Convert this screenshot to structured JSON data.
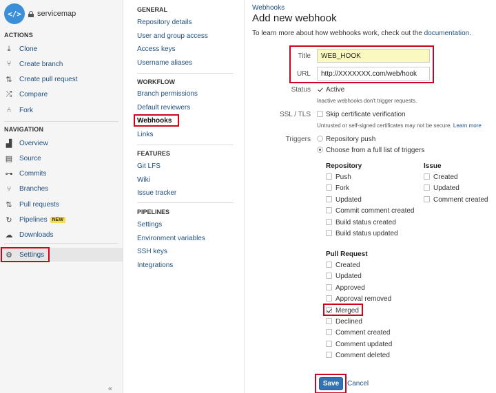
{
  "repo": {
    "avatar_glyph": "</>",
    "name": "servicemap",
    "avatar_color": "#3b8fd8"
  },
  "sidebar": {
    "actions_heading": "ACTIONS",
    "actions": [
      {
        "label": "Clone",
        "icon": "download-icon",
        "glyph": "⤓"
      },
      {
        "label": "Create branch",
        "icon": "branch-icon",
        "glyph": "⑂"
      },
      {
        "label": "Create pull request",
        "icon": "pull-request-icon",
        "glyph": "⇅"
      },
      {
        "label": "Compare",
        "icon": "compare-icon",
        "glyph": "⤮"
      },
      {
        "label": "Fork",
        "icon": "fork-icon",
        "glyph": "⑃"
      }
    ],
    "navigation_heading": "NAVIGATION",
    "navigation": [
      {
        "label": "Overview",
        "icon": "overview-icon",
        "glyph": "▟"
      },
      {
        "label": "Source",
        "icon": "source-icon",
        "glyph": "▤"
      },
      {
        "label": "Commits",
        "icon": "commits-icon",
        "glyph": "⊶"
      },
      {
        "label": "Branches",
        "icon": "branches-icon",
        "glyph": "⑂"
      },
      {
        "label": "Pull requests",
        "icon": "pull-requests-icon",
        "glyph": "⇅"
      },
      {
        "label": "Pipelines",
        "icon": "pipelines-icon",
        "glyph": "↻",
        "badge": "NEW"
      },
      {
        "label": "Downloads",
        "icon": "downloads-icon",
        "glyph": "☁"
      }
    ],
    "settings": {
      "label": "Settings",
      "icon": "gear-icon",
      "glyph": "⚙"
    },
    "collapse": "«"
  },
  "settings_nav": {
    "general_heading": "GENERAL",
    "general": [
      "Repository details",
      "User and group access",
      "Access keys",
      "Username aliases"
    ],
    "workflow_heading": "WORKFLOW",
    "workflow": [
      "Branch permissions",
      "Default reviewers",
      "Webhooks",
      "Links"
    ],
    "features_heading": "FEATURES",
    "features": [
      "Git LFS",
      "Wiki",
      "Issue tracker"
    ],
    "pipelines_heading": "PIPELINES",
    "pipelines": [
      "Settings",
      "Environment variables",
      "SSH keys",
      "Integrations"
    ]
  },
  "main": {
    "breadcrumb": "Webhooks",
    "title": "Add new webhook",
    "intro_text": "To learn more about how webhooks work, check out the ",
    "intro_link": "documentation",
    "intro_end": ".",
    "title_label": "Title",
    "title_value": "WEB_HOOK",
    "url_label": "URL",
    "url_value": "http://XXXXXXX.com/web/hook",
    "status_label": "Status",
    "status_option": "Active",
    "status_help": "Inactive webhooks don't trigger requests.",
    "ssl_label": "SSL / TLS",
    "ssl_option": "Skip certificate verification",
    "ssl_help": "Untrusted or self-signed certificates may not be secure.",
    "ssl_learn": "Learn more",
    "triggers_label": "Triggers",
    "trigger_push": "Repository push",
    "trigger_full": "Choose from a full list of triggers",
    "repository_heading": "Repository",
    "repository_triggers": [
      {
        "label": "Push",
        "checked": false
      },
      {
        "label": "Fork",
        "checked": false
      },
      {
        "label": "Updated",
        "checked": false
      },
      {
        "label": "Commit comment created",
        "checked": false
      },
      {
        "label": "Build status created",
        "checked": false
      },
      {
        "label": "Build status updated",
        "checked": false
      }
    ],
    "issue_heading": "Issue",
    "issue_triggers": [
      {
        "label": "Created",
        "checked": false
      },
      {
        "label": "Updated",
        "checked": false
      },
      {
        "label": "Comment created",
        "checked": false
      }
    ],
    "pr_heading": "Pull Request",
    "pr_triggers": [
      {
        "label": "Created",
        "checked": false
      },
      {
        "label": "Updated",
        "checked": false
      },
      {
        "label": "Approved",
        "checked": false
      },
      {
        "label": "Approval removed",
        "checked": false
      },
      {
        "label": "Merged",
        "checked": true
      },
      {
        "label": "Declined",
        "checked": false
      },
      {
        "label": "Comment created",
        "checked": false
      },
      {
        "label": "Comment updated",
        "checked": false
      },
      {
        "label": "Comment deleted",
        "checked": false
      }
    ],
    "save_label": "Save",
    "cancel_label": "Cancel"
  },
  "colors": {
    "link": "#205081",
    "primary_button": "#3572b0",
    "highlight": "#d0021b",
    "badge": "#f8dc49"
  }
}
